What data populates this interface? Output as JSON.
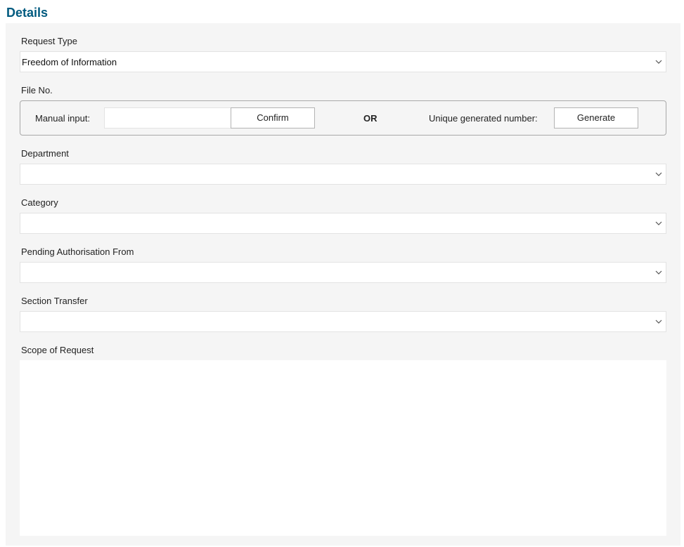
{
  "page": {
    "title": "Details"
  },
  "form": {
    "request_type": {
      "label": "Request Type",
      "value": "Freedom of Information"
    },
    "file_no": {
      "label": "File No.",
      "manual_label": "Manual input:",
      "manual_value": "",
      "confirm_label": "Confirm",
      "or_label": "OR",
      "unique_label": "Unique generated number:",
      "generate_label": "Generate"
    },
    "department": {
      "label": "Department",
      "value": ""
    },
    "category": {
      "label": "Category",
      "value": ""
    },
    "pending_authorisation": {
      "label": "Pending Authorisation From",
      "value": ""
    },
    "section_transfer": {
      "label": "Section Transfer",
      "value": ""
    },
    "scope": {
      "label": "Scope of Request",
      "value": ""
    }
  },
  "icons": {
    "dropdown": "chevron-down-icon"
  },
  "colors": {
    "title": "#005a7f",
    "panel_bg": "#f5f5f5"
  }
}
